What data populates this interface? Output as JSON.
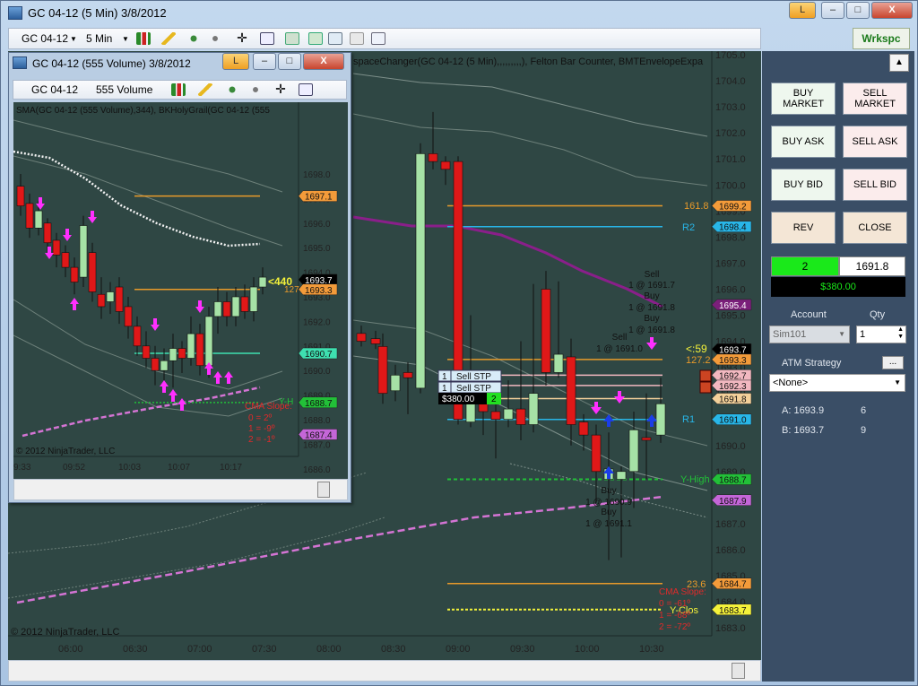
{
  "window": {
    "title": "GC 04-12 (5 Min)  3/8/2012",
    "link_btn": "L",
    "min": "–",
    "max": "□",
    "close": "X"
  },
  "toolbar": {
    "instrument": "GC 04-12",
    "interval": "5 Min",
    "workspace": "Wrkspc"
  },
  "main_chart": {
    "header": "spaceChanger(GC 04-12 (5 Min),,,,,,,,,), Felton Bar Counter, BMTEnvelopeExpa",
    "copyright": "© 2012 NinjaTrader, LLC",
    "time_ticks": [
      "06:00",
      "06:30",
      "07:00",
      "07:30",
      "08:00",
      "08:30",
      "09:00",
      "09:30",
      "10:00",
      "10:30"
    ],
    "price_ticks": [
      "1705.0",
      "1704.0",
      "1703.0",
      "1702.0",
      "1701.0",
      "1700.0",
      "1699.0",
      "1698.0",
      "1697.0",
      "1696.0",
      "1695.0",
      "1694.0",
      "1693.0",
      "1692.0",
      "1691.0",
      "1690.0",
      "1689.0",
      "1688.0",
      "1687.0",
      "1686.0",
      "1685.0",
      "1684.0",
      "1683.0"
    ],
    "price_tags": [
      {
        "text": "1699.2",
        "bg": "#f39b3a"
      },
      {
        "text": "1698.4",
        "bg": "#28b6e8"
      },
      {
        "text": "1695.4",
        "bg": "#7a1f7a"
      },
      {
        "text": "1693.7",
        "bg": "#000000"
      },
      {
        "text": "1693.3",
        "bg": "#f39b3a"
      },
      {
        "text": "1692.7",
        "bg": "#f2b8c0"
      },
      {
        "text": "1692.3",
        "bg": "#f2b8c0"
      },
      {
        "text": "1691.8",
        "bg": "#f3d09a"
      },
      {
        "text": "1691.0",
        "bg": "#28b6e8"
      },
      {
        "text": "1688.7",
        "bg": "#22c038"
      },
      {
        "text": "1687.9",
        "bg": "#c466d8"
      },
      {
        "text": "1684.7",
        "bg": "#f39b3a"
      },
      {
        "text": "1683.7",
        "bg": "#f4f23a"
      }
    ],
    "labels": {
      "fib161": "161.8",
      "r2": "R2",
      "timer": "<:59",
      "fib127": "127.2",
      "r1": "R1",
      "yhigh": "Y-High",
      "fib23": "23.6",
      "yclose": "Y-Clos",
      "sell1": "Sell",
      "sell1b": "1 @ 1691.7",
      "buy1": "Buy",
      "buy1b": "1 @ 1691.8",
      "buy2": "Buy",
      "buy2b": "1 @ 1691.8",
      "sell2": "Sell",
      "sell2b": "1 @ 1691.0",
      "buy3": "Buy",
      "buy3b": "1 @ 1690.9",
      "buy4": "Buy",
      "buy4b": "1 @ 1691.1",
      "cma_title": "CMA Slope:",
      "cma0": "0 = -61º",
      "cma1": "1 = -68º",
      "cma2": "2 = -72º"
    },
    "orders": [
      {
        "qty": "1",
        "label": "Sell STP"
      },
      {
        "qty": "1",
        "label": "Sell STP"
      }
    ],
    "position": {
      "pnl": "$380.00",
      "qty": "2"
    }
  },
  "panel": {
    "buy_market": "BUY MARKET",
    "sell_market": "SELL MARKET",
    "buy_ask": "BUY ASK",
    "sell_ask": "SELL ASK",
    "buy_bid": "BUY BID",
    "sell_bid": "SELL BID",
    "rev": "REV",
    "close": "CLOSE",
    "pos_qty": "2",
    "pos_price": "1691.8",
    "pnl": "$380.00",
    "account_label": "Account",
    "qty_label": "Qty",
    "account": "Sim101",
    "qty": "1",
    "atm_label": "ATM Strategy",
    "atm_btn": "...",
    "atm": "<None>",
    "a_label": "A: 1693.9",
    "a_qty": "6",
    "b_label": "B: 1693.7",
    "b_qty": "9"
  },
  "inner": {
    "title": "GC 04-12 (555 Volume)  3/8/2012",
    "link_btn": "L",
    "instrument": "GC 04-12",
    "interval": "555 Volume",
    "header": "SMA(GC 04-12 (555 Volume),344), BKHolyGrail(GC 04-12 (555",
    "copyright": "© 2012 NinjaTrader, LLC",
    "timer": "<440",
    "price_ticks": [
      "1698.0",
      "1697.0",
      "1696.0",
      "1695.0",
      "1694.0",
      "1693.0",
      "1692.0",
      "1691.0",
      "1690.0",
      "1689.0",
      "1688.0",
      "1687.0",
      "1686.0",
      "1685.0"
    ],
    "time_ticks": [
      "9:33",
      "09:52",
      "10:03",
      "10:07",
      "10:17"
    ],
    "price_tags": [
      {
        "text": "1697.1",
        "bg": "#f39b3a"
      },
      {
        "text": "1693.7",
        "bg": "#000000"
      },
      {
        "text": "1693.3",
        "bg": "#f39b3a"
      },
      {
        "text": "1690.7",
        "bg": "#3ee0b0"
      },
      {
        "text": "1688.7",
        "bg": "#22c038"
      },
      {
        "text": "1687.4",
        "bg": "#c466d8"
      }
    ],
    "labels": {
      "yh": "Y-H",
      "f127": "127",
      "cma_title": "CMA Slope:",
      "cma0": "0 = 2º",
      "cma1": "1 = -9º",
      "cma2": "2 = -1º"
    }
  }
}
